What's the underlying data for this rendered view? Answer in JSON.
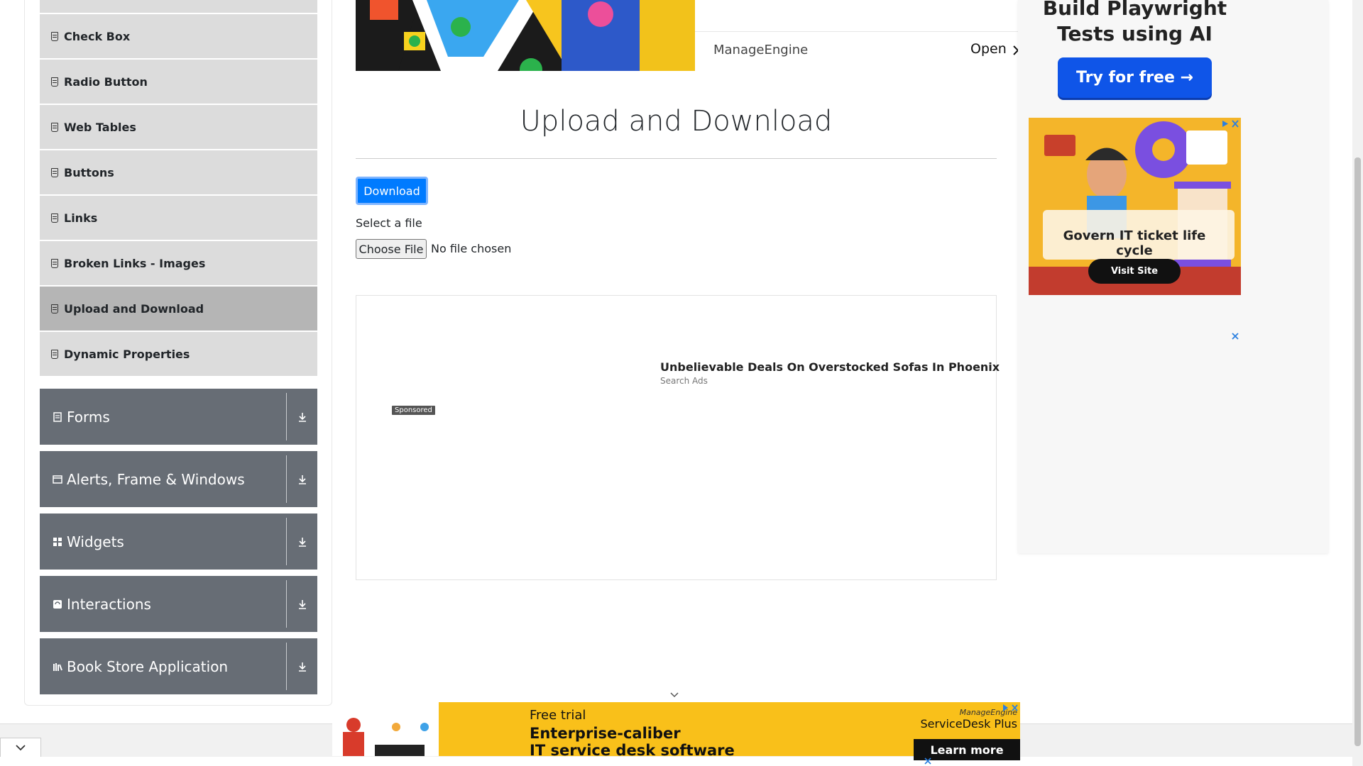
{
  "sidebar": {
    "items": [
      {
        "label": ""
      },
      {
        "label": "Check Box"
      },
      {
        "label": "Radio Button"
      },
      {
        "label": "Web Tables"
      },
      {
        "label": "Buttons"
      },
      {
        "label": "Links"
      },
      {
        "label": "Broken Links - Images"
      },
      {
        "label": "Upload and Download",
        "active": true
      },
      {
        "label": "Dynamic Properties"
      }
    ],
    "groups": [
      {
        "label": "Forms",
        "icon": "form-icon"
      },
      {
        "label": "Alerts, Frame & Windows",
        "icon": "window-icon"
      },
      {
        "label": "Widgets",
        "icon": "widgets-icon"
      },
      {
        "label": "Interactions",
        "icon": "interactions-icon"
      },
      {
        "label": "Book Store Application",
        "icon": "bookstore-icon"
      }
    ]
  },
  "top_ad": {
    "brand": "ManageEngine",
    "open_label": "Open"
  },
  "main": {
    "title": "Upload and Download",
    "download_label": "Download",
    "select_label": "Select a file",
    "choose_file_label": "Choose File",
    "file_status": "No file chosen"
  },
  "center_ad": {
    "headline": "Unbelievable Deals On Overstocked Sofas In Phoenix",
    "source": "Search Ads",
    "sponsored": "Sponsored"
  },
  "right_ad": {
    "title_line1": "Build Playwright",
    "title_line2": "Tests using AI",
    "cta": "Try for free →",
    "govern_text": "Govern IT ticket life cycle",
    "visit_label": "Visit Site",
    "logo_text": "ManageEngine ServiceDesk Plus"
  },
  "bottom_ad": {
    "free_trial": "Free trial",
    "line1": "Enterprise-caliber",
    "line2": "IT service desk software",
    "brand_small": "ManageEngine",
    "brand_big": "ServiceDesk Plus",
    "learn_more": "Learn more"
  },
  "colors": {
    "primary": "#007bff",
    "group_header": "#676d75",
    "menu_item": "#dcdcdc",
    "menu_active": "#b5b5b5",
    "ad_yellow": "#f9c01a",
    "cta_blue": "#0f55e8"
  }
}
